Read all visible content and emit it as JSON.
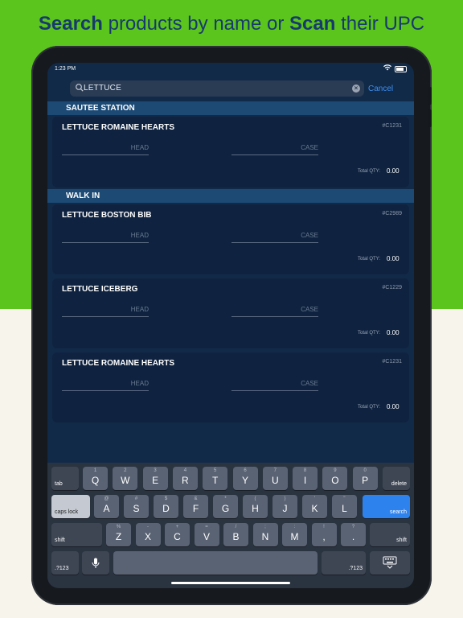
{
  "headline": {
    "part1": "Search",
    "part2": " products by name or ",
    "part3": "Scan",
    "part4": " their UPC"
  },
  "status": {
    "time": "1:23 PM"
  },
  "search": {
    "query": "LETTUCE",
    "cancel": "Cancel"
  },
  "sections": [
    {
      "title": "SAUTEE STATION",
      "items": [
        {
          "name": "LETTUCE ROMAINE HEARTS",
          "code": "#C1231",
          "unit1": "HEAD",
          "unit2": "CASE",
          "qty_label": "Total QTY:",
          "qty": "0.00"
        }
      ]
    },
    {
      "title": "WALK IN",
      "items": [
        {
          "name": "LETTUCE BOSTON BIB",
          "code": "#C2989",
          "unit1": "HEAD",
          "unit2": "CASE",
          "qty_label": "Total QTY:",
          "qty": "0.00"
        },
        {
          "name": "LETTUCE ICEBERG",
          "code": "#C1229",
          "unit1": "HEAD",
          "unit2": "CASE",
          "qty_label": "Total QTY:",
          "qty": "0.00"
        },
        {
          "name": "LETTUCE ROMAINE HEARTS",
          "code": "#C1231",
          "unit1": "HEAD",
          "unit2": "CASE",
          "qty_label": "Total QTY:",
          "qty": "0.00"
        }
      ]
    }
  ],
  "keyboard": {
    "row1": [
      {
        "main": "Q",
        "alt": "1"
      },
      {
        "main": "W",
        "alt": "2"
      },
      {
        "main": "E",
        "alt": "3"
      },
      {
        "main": "R",
        "alt": "4"
      },
      {
        "main": "T",
        "alt": "5"
      },
      {
        "main": "Y",
        "alt": "6"
      },
      {
        "main": "U",
        "alt": "7"
      },
      {
        "main": "I",
        "alt": "8"
      },
      {
        "main": "O",
        "alt": "9"
      },
      {
        "main": "P",
        "alt": "0"
      }
    ],
    "row2": [
      {
        "main": "A",
        "alt": "@"
      },
      {
        "main": "S",
        "alt": "#"
      },
      {
        "main": "D",
        "alt": "$"
      },
      {
        "main": "F",
        "alt": "&"
      },
      {
        "main": "G",
        "alt": "*"
      },
      {
        "main": "H",
        "alt": "("
      },
      {
        "main": "J",
        "alt": ")"
      },
      {
        "main": "K",
        "alt": "'"
      },
      {
        "main": "L",
        "alt": "\""
      }
    ],
    "row3": [
      {
        "main": "Z",
        "alt": "%"
      },
      {
        "main": "X",
        "alt": "-"
      },
      {
        "main": "C",
        "alt": "+"
      },
      {
        "main": "V",
        "alt": "="
      },
      {
        "main": "B",
        "alt": "/"
      },
      {
        "main": "N",
        "alt": ";"
      },
      {
        "main": "M",
        "alt": ":"
      },
      {
        "main": ",",
        "alt": "!"
      },
      {
        "main": ".",
        "alt": "?"
      }
    ],
    "tab": "tab",
    "delete": "delete",
    "caps_lock": "caps lock",
    "search": "search",
    "shift": "shift",
    "num": ".?123"
  }
}
